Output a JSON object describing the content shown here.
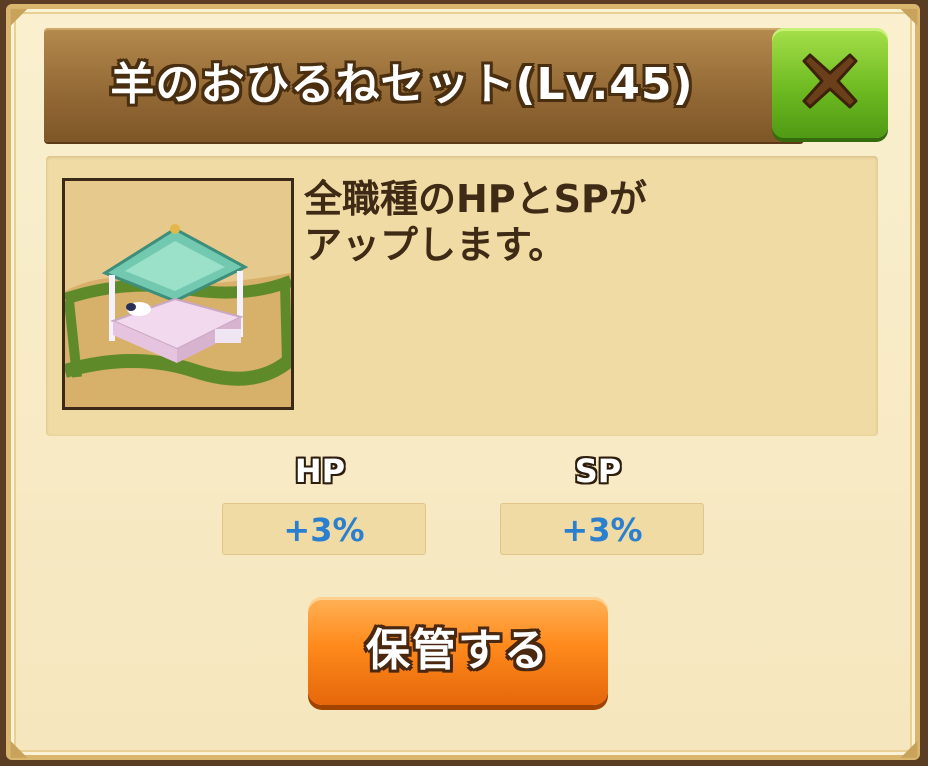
{
  "dialog": {
    "title": "羊のおひるねセット(Lv.45)",
    "close_icon": "close-x-icon",
    "description": "全職種のHPとSPが\nアップします。",
    "item_image": "sheep-canopy-bed-image",
    "stats": [
      {
        "label": "HP",
        "value": "+3%"
      },
      {
        "label": "SP",
        "value": "+3%"
      }
    ],
    "store_button_label": "保管する"
  },
  "colors": {
    "title_bar": "#946a36",
    "close_button": "#6fbb22",
    "store_button": "#ff8a1c",
    "stat_value": "#2a7fcf",
    "panel": "#f0dba4"
  }
}
